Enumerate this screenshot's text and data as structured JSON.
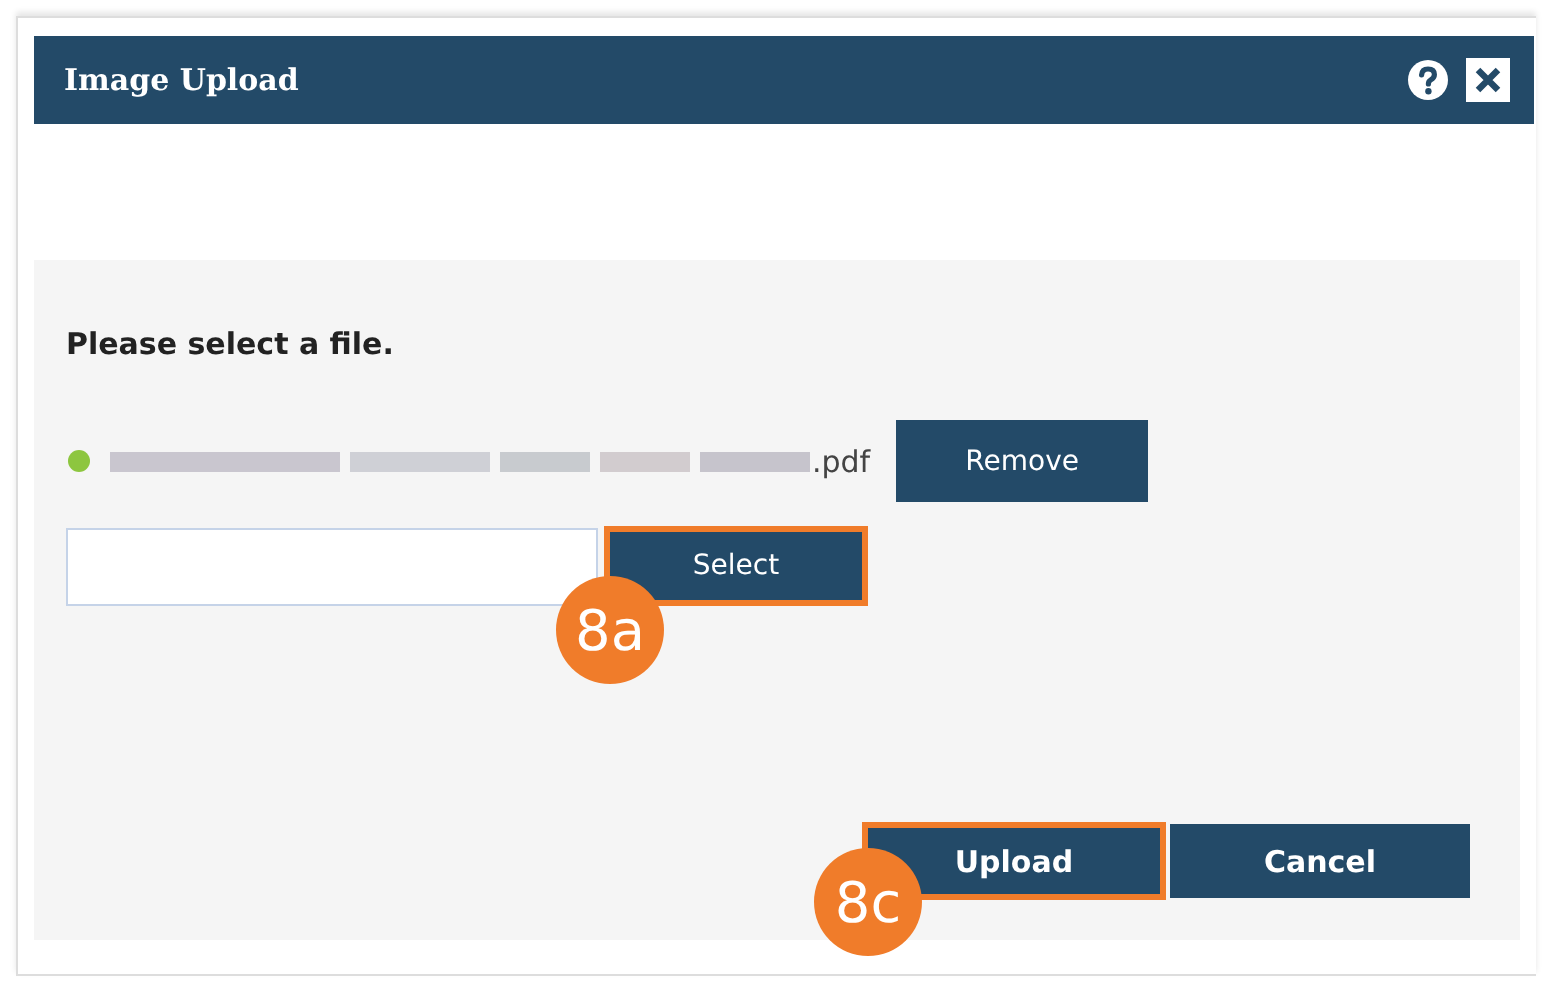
{
  "window": {
    "title": "Image Upload"
  },
  "prompt": "Please select a file.",
  "file": {
    "uploaded": true,
    "extension": ".pdf",
    "remove_label": "Remove"
  },
  "select": {
    "label": "Select",
    "highlighted": true,
    "callout": "8a"
  },
  "buttons": [
    {
      "label": "Upload",
      "highlighted": true,
      "callout": "8c"
    },
    {
      "label": "Cancel",
      "highlighted": false
    }
  ]
}
